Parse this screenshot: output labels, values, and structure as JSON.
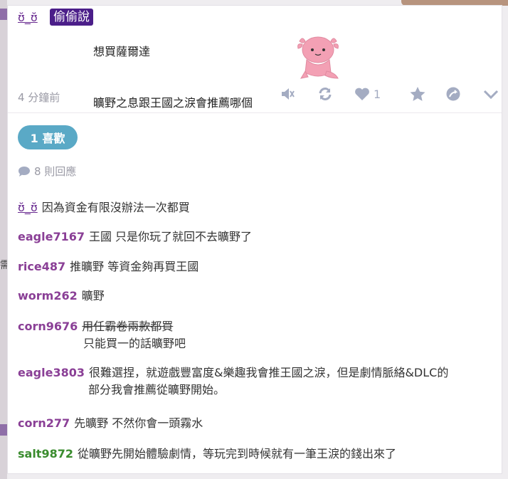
{
  "background": {
    "left_fragment": "需"
  },
  "post": {
    "author": "ʊ̆_ʊ̆",
    "tag": "偷偷說",
    "lines": [
      "想買薩爾達",
      "曠野之息跟王國之淚會推薦哪個"
    ],
    "time": "4 分鐘前",
    "like_count": "1",
    "sticker": "pink-axolotl-sticker"
  },
  "likes": {
    "label": "1 喜歡"
  },
  "replies": {
    "label": "8 則回應"
  },
  "comments": [
    {
      "user": "ʊ̆_ʊ̆",
      "text": "因為資金有限沒辦法一次都買"
    },
    {
      "user": "eagle7167",
      "text": "王國 只是你玩了就回不去曠野了"
    },
    {
      "user": "rice487",
      "text": "推曠野 等資金夠再買王國"
    },
    {
      "user": "worm262",
      "text": "曠野"
    },
    {
      "user": "corn9676",
      "text": "用任霸卷兩款都買",
      "text2": "只能買一的話曠野吧"
    },
    {
      "user": "eagle3803",
      "text": "很難選捏，就遊戲豐富度&樂趣我會推王國之淚，但是劇情脈絡&DLC的",
      "text2": "部分我會推薦從曠野開始。"
    },
    {
      "user": "corn277",
      "text": "先曠野 不然你會一頭霧水"
    },
    {
      "user": "salt9872",
      "text": "從曠野先開始體驗劇情，等玩完到時候就有一筆王淚的錢出來了"
    }
  ],
  "colors": {
    "tag_bg": "#4b1e89",
    "username": "#8a3f96",
    "username_green": "#3a8c2e",
    "likes_pill": "#5aa9c6",
    "icon": "#a4acc2"
  },
  "icons": [
    "mute-icon",
    "repost-icon",
    "heart-icon",
    "star-icon",
    "share-icon",
    "chevron-down-icon",
    "speech-bubble-icon"
  ]
}
